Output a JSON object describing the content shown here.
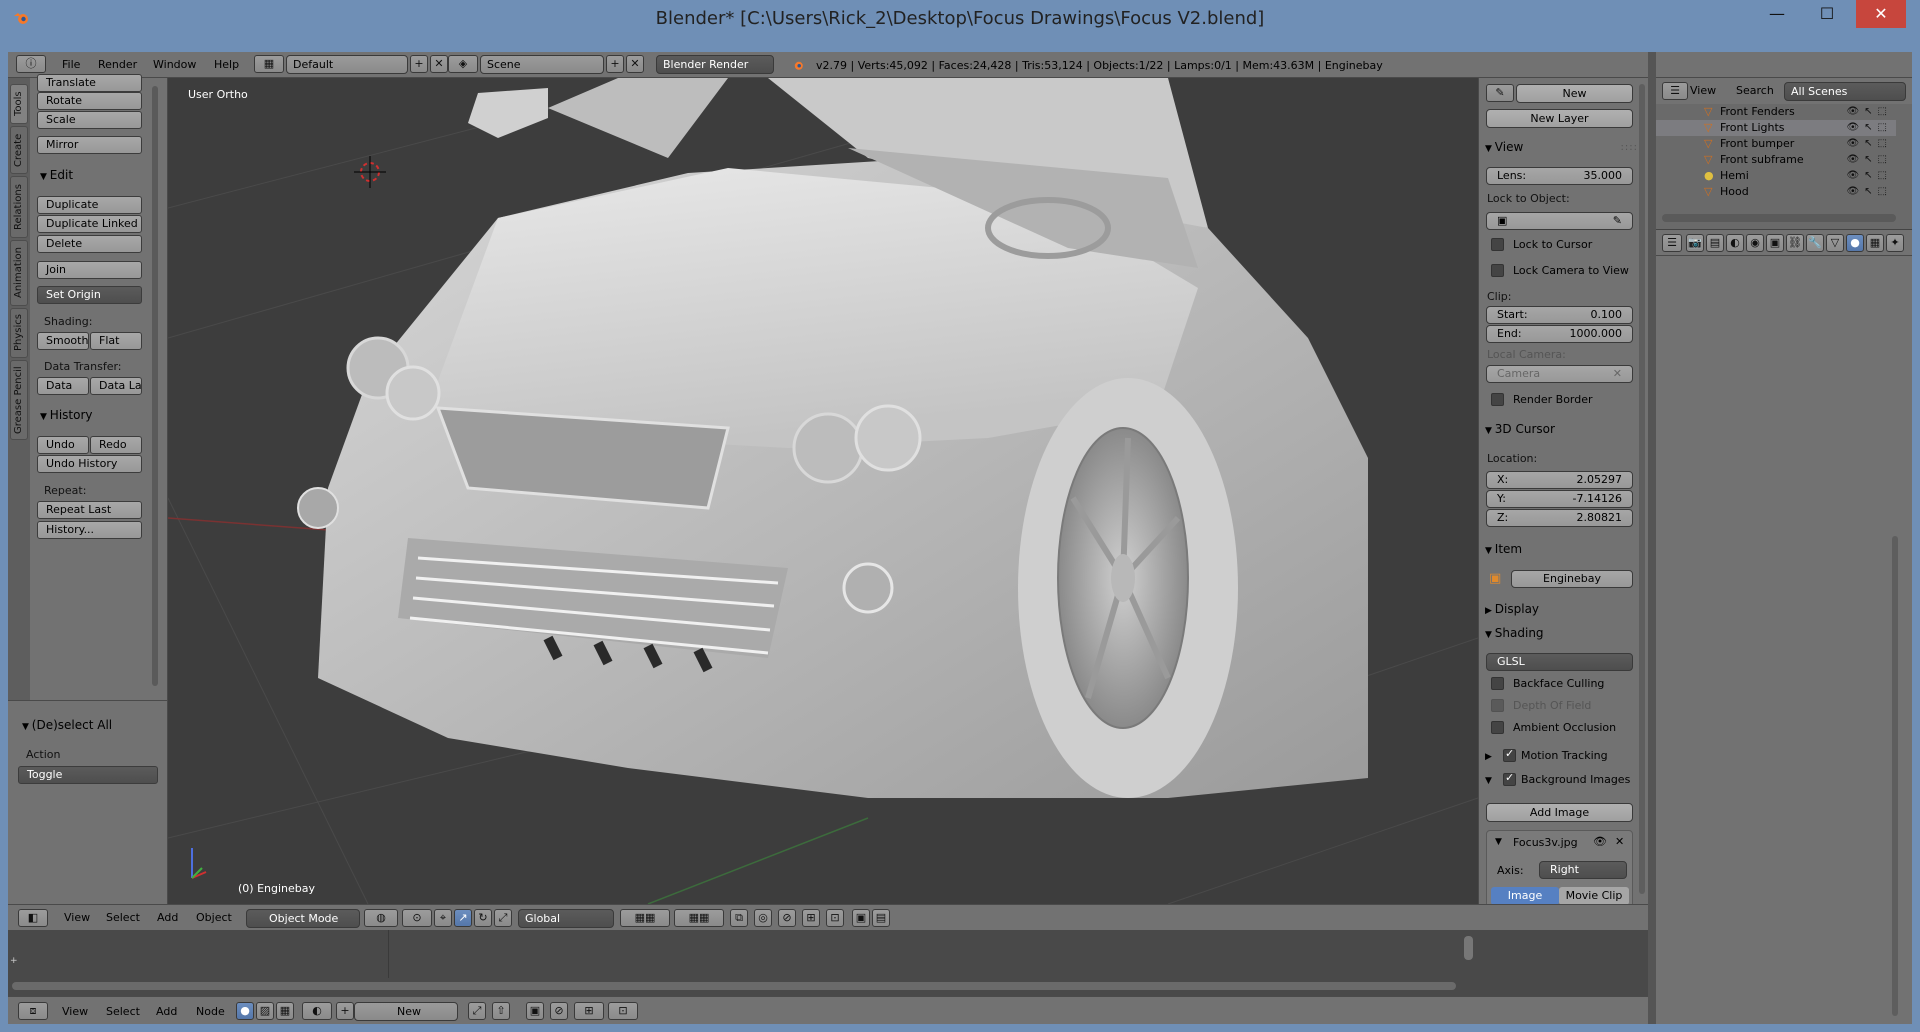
{
  "window": {
    "title": "Blender* [C:\\Users\\Rick_2\\Desktop\\Focus Drawings\\Focus V2.blend]",
    "minimize": "—",
    "maximize": "☐",
    "close": "✕"
  },
  "info_header": {
    "menus": [
      "File",
      "Render",
      "Window",
      "Help"
    ],
    "layout": "Default",
    "scene": "Scene",
    "engine": "Blender Render",
    "stats": "v2.79 | Verts:45,092 | Faces:24,428 | Tris:53,124 | Objects:1/22 | Lamps:0/1 | Mem:43.63M | Enginebay"
  },
  "toolshelf": {
    "tabs": [
      "Tools",
      "Create",
      "Relations",
      "Animation",
      "Physics",
      "Grease Pencil"
    ],
    "transform_buttons": [
      "Translate",
      "Rotate",
      "Scale"
    ],
    "mirror": "Mirror",
    "edit_title": "Edit",
    "edit_buttons": [
      "Duplicate",
      "Duplicate Linked",
      "Delete"
    ],
    "join": "Join",
    "set_origin": "Set Origin",
    "shading_label": "Shading:",
    "smooth": "Smooth",
    "flat": "Flat",
    "data_transfer_label": "Data Transfer:",
    "data": "Data",
    "data_layout": "Data La",
    "history_title": "History",
    "undo": "Undo",
    "redo": "Redo",
    "undo_history": "Undo History",
    "repeat_label": "Repeat:",
    "repeat_last": "Repeat Last",
    "history_btn": "History...",
    "operator_title": "(De)select All",
    "action_label": "Action",
    "action_value": "Toggle"
  },
  "viewport": {
    "view_label": "User Ortho",
    "object_label": "(0) Enginebay"
  },
  "npanel": {
    "new": "New",
    "new_layer": "New Layer",
    "view_title": "View",
    "lens_label": "Lens:",
    "lens_value": "35.000",
    "lock_to_object": "Lock to Object:",
    "lock_to_cursor": "Lock to Cursor",
    "lock_camera": "Lock Camera to View",
    "clip_label": "Clip:",
    "start_label": "Start:",
    "start_value": "0.100",
    "end_label": "End:",
    "end_value": "1000.000",
    "local_camera": "Local Camera:",
    "camera": "Camera",
    "render_border": "Render Border",
    "cursor_title": "3D Cursor",
    "location_label": "Location:",
    "x_label": "X:",
    "x_value": "2.05297",
    "y_label": "Y:",
    "y_value": "-7.14126",
    "z_label": "Z:",
    "z_value": "2.80821",
    "item_title": "Item",
    "item_name": "Enginebay",
    "display_title": "Display",
    "shading_title": "Shading",
    "shading_mode": "GLSL",
    "backface": "Backface Culling",
    "dof": "Depth Of Field",
    "ao": "Ambient Occlusion",
    "motion_tracking": "Motion Tracking",
    "bg_images": "Background Images",
    "add_image": "Add Image",
    "image_name": "Focus3v.jpg",
    "axis_label": "Axis:",
    "axis_value": "Right",
    "tab_image": "Image",
    "tab_movie": "Movie Clip"
  },
  "outliner": {
    "view": "View",
    "search": "Search",
    "scenes": "All Scenes",
    "rows": [
      "Front Fenders",
      "Front Lights",
      "Front bumper",
      "Front subframe",
      "Hemi",
      "Hood"
    ]
  },
  "vp_header": {
    "menus": [
      "View",
      "Select",
      "Add",
      "Object"
    ],
    "mode": "Object Mode",
    "orientation": "Global"
  },
  "node_header": {
    "menus": [
      "View",
      "Select",
      "Add",
      "Node"
    ],
    "new": "New"
  }
}
